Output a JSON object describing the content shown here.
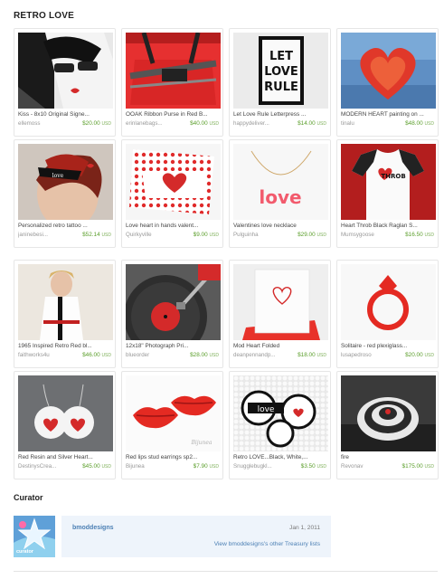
{
  "title": "RETRO LOVE",
  "items": [
    {
      "title": "Kiss - 8x10 Original Signe...",
      "shop": "ellemoss",
      "price": "$20.00",
      "currency": "USD"
    },
    {
      "title": "OOAK Ribbon Purse in Red B...",
      "shop": "erinlanebags...",
      "price": "$40.00",
      "currency": "USD"
    },
    {
      "title": "Let Love Rule Letterpress ...",
      "shop": "happydeliver...",
      "price": "$14.00",
      "currency": "USD"
    },
    {
      "title": "MODERN HEART painting on ...",
      "shop": "tinalu",
      "price": "$48.00",
      "currency": "USD"
    },
    {
      "title": "Personalized retro tattoo ...",
      "shop": "janinebesi...",
      "price": "$52.14",
      "currency": "USD"
    },
    {
      "title": "Love heart in hands valent...",
      "shop": "Quirkyville",
      "price": "$9.00",
      "currency": "USD"
    },
    {
      "title": "Valentines love necklace",
      "shop": "Pulguinha",
      "price": "$29.00",
      "currency": "USD"
    },
    {
      "title": "Heart Throb Black Raglan S...",
      "shop": "Mumsygoose",
      "price": "$16.50",
      "currency": "USD"
    },
    {
      "title": "1965 Inspired Retro Red bl...",
      "shop": "faithworks4u",
      "price": "$46.00",
      "currency": "USD"
    },
    {
      "title": "12x18\" Photograph Pri...",
      "shop": "blueorder",
      "price": "$28.00",
      "currency": "USD"
    },
    {
      "title": "Mod Heart Folded",
      "shop": "deanpennandp...",
      "price": "$18.00",
      "currency": "USD"
    },
    {
      "title": "Solitaire - red plexiglass...",
      "shop": "lusapedroso",
      "price": "$20.00",
      "currency": "USD"
    },
    {
      "title": "Red Resin and Silver Heart...",
      "shop": "DestinysCrea...",
      "price": "$45.00",
      "currency": "USD"
    },
    {
      "title": "Red lips stud earrings sp2...",
      "shop": "Bijunea",
      "price": "$7.90",
      "currency": "USD"
    },
    {
      "title": "Retro LOVE...Black, White,...",
      "shop": "Snugglebugkl...",
      "price": "$3.50",
      "currency": "USD"
    },
    {
      "title": "fire",
      "shop": "Revonav",
      "price": "$175.00",
      "currency": "USD"
    }
  ],
  "image_text": {
    "let_love_rule": [
      "LET",
      "LOVE",
      "RULE"
    ],
    "love_script": "love",
    "throb": "THROB",
    "watermark": "Bijunea"
  },
  "curator": {
    "heading": "Curator",
    "avatar_label": "curator",
    "name": "bmoddesigns",
    "date": "Jan 1, 2011",
    "link": "View bmoddesigns's other Treasury lists"
  },
  "colors": {
    "price_green": "#5a9e2a",
    "link_blue": "#4b7fb4",
    "curator_bg": "#eef4fb",
    "accent_red": "#d42a2a"
  }
}
